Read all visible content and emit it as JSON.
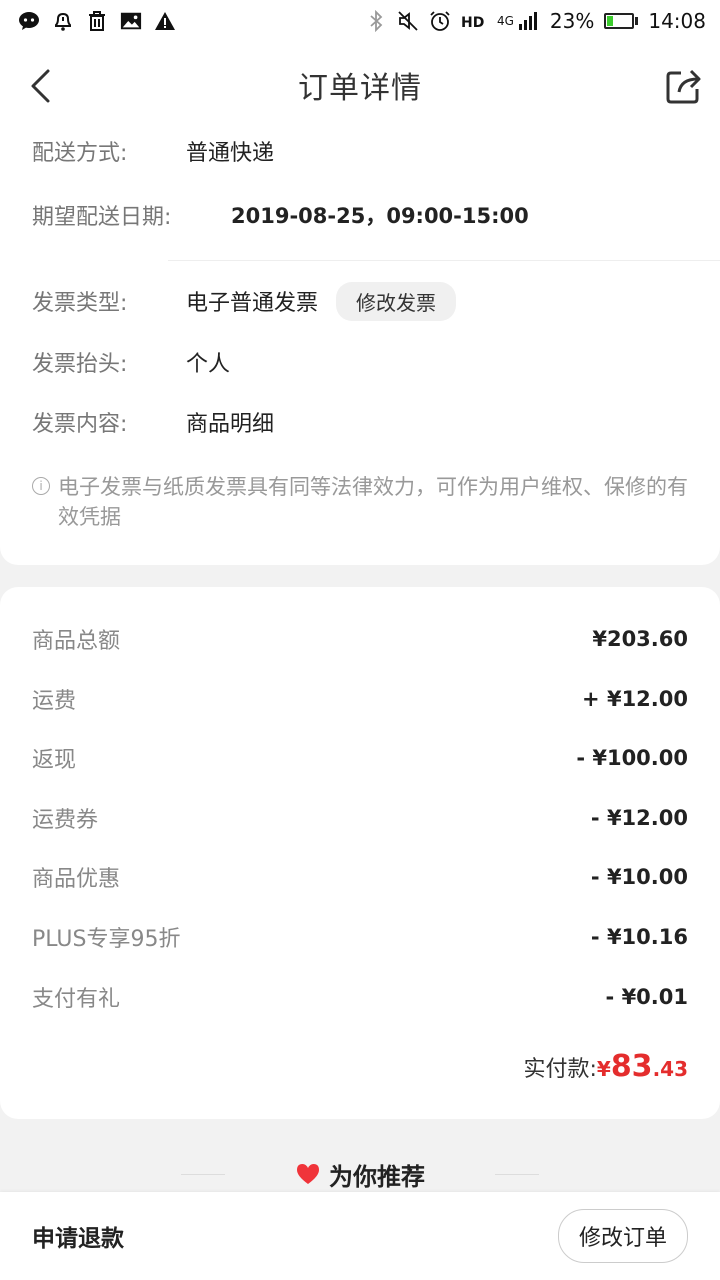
{
  "status_bar": {
    "battery_pct": "23%",
    "network": "4G",
    "time": "14:08",
    "battery_level": 0.23,
    "colors": {
      "battery": "#3ccc2e"
    }
  },
  "header": {
    "title": "订单详情"
  },
  "delivery": {
    "method_label": "配送方式:",
    "method_value": "普通快递",
    "date_label": "期望配送日期:",
    "date_value": "2019-08-25，09:00-15:00"
  },
  "invoice": {
    "type_label": "发票类型:",
    "type_value": "电子普通发票",
    "modify_label": "修改发票",
    "title_label": "发票抬头:",
    "title_value": "个人",
    "content_label": "发票内容:",
    "content_value": "商品明细",
    "notice_icon": "i",
    "notice": "电子发票与纸质发票具有同等法律效力，可作为用户维权、保修的有效凭据"
  },
  "fees": [
    {
      "label": "商品总额",
      "value": "¥203.60"
    },
    {
      "label": "运费",
      "value": "+ ¥12.00"
    },
    {
      "label": "返现",
      "value": "- ¥100.00"
    },
    {
      "label": "运费券",
      "value": "- ¥12.00"
    },
    {
      "label": "商品优惠",
      "value": "- ¥10.00"
    },
    {
      "label": "PLUS专享95折",
      "value": "- ¥10.16"
    },
    {
      "label": "支付有礼",
      "value": "- ¥0.01"
    }
  ],
  "total": {
    "label": "实付款:",
    "currency": "¥",
    "integer": "83",
    "decimal": ".43",
    "color": "#e42d2d"
  },
  "recommend": {
    "title": "为你推荐"
  },
  "bottom": {
    "refund_label": "申请退款",
    "modify_order_label": "修改订单"
  }
}
